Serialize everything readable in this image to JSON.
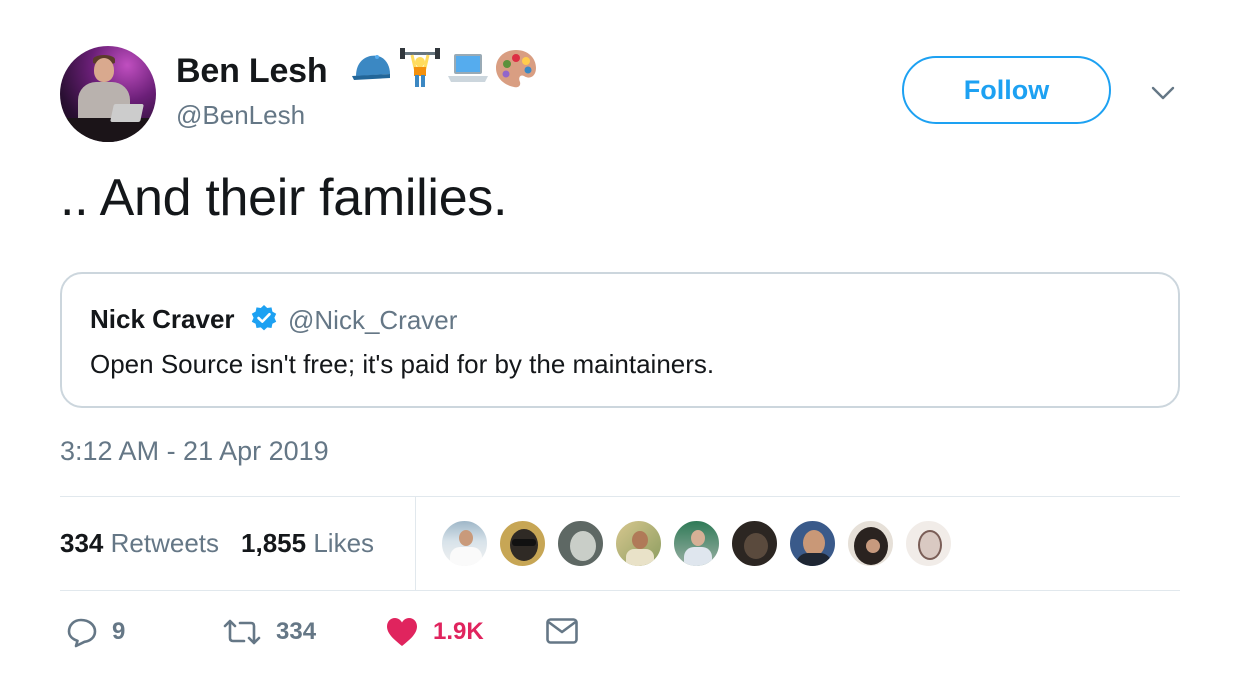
{
  "author": {
    "name": "Ben Lesh",
    "handle": "@BenLesh",
    "emojis": [
      "cap-emoji",
      "weightlifter-emoji",
      "laptop-emoji",
      "artist-palette-emoji"
    ]
  },
  "actions_header": {
    "follow_label": "Follow"
  },
  "tweet": {
    "text": ".. And their families.",
    "timestamp": "3:12 AM - 21 Apr 2019"
  },
  "quoted": {
    "name": "Nick Craver",
    "handle": "@Nick_Craver",
    "text": "Open Source isn't free; it's paid for by the maintainers.",
    "verified": true
  },
  "stats": {
    "retweets_count": "334",
    "retweets_label": "Retweets",
    "likes_count": "1,855",
    "likes_label": "Likes",
    "liker_avatars": 9
  },
  "actions": {
    "reply_count": "9",
    "retweet_count": "334",
    "like_count": "1.9K"
  },
  "colors": {
    "accent": "#1da1f2",
    "like": "#e0245e",
    "muted": "#657786",
    "text": "#14171a",
    "border": "#ccd6dd"
  }
}
